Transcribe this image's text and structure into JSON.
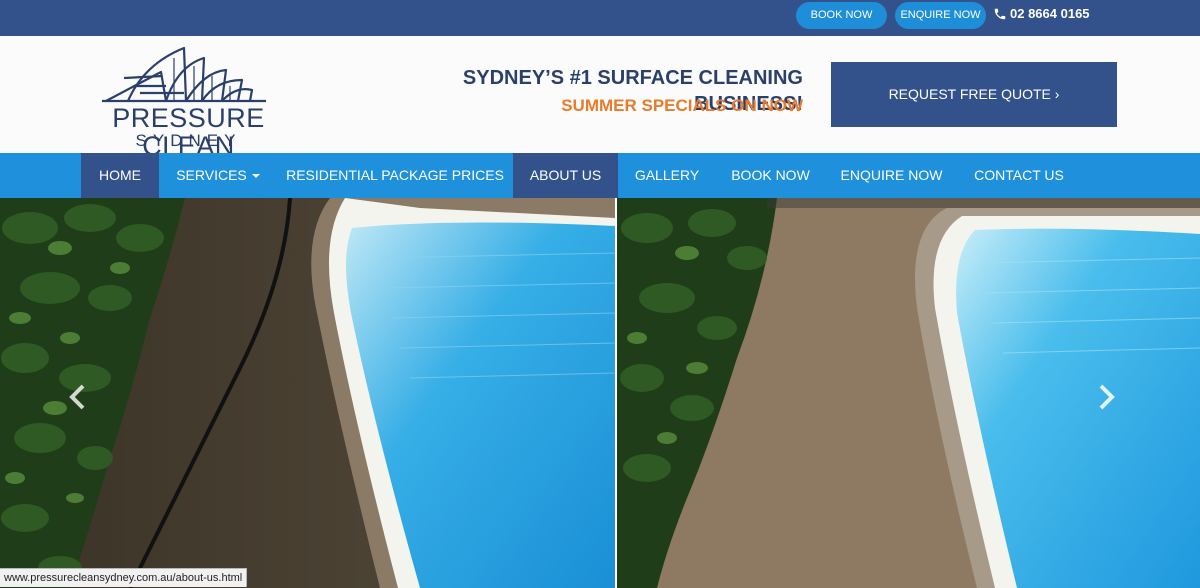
{
  "topbar": {
    "book_now": "BOOK NOW",
    "enquire_now": "ENQUIRE NOW",
    "phone": "02 8664 0165"
  },
  "logo": {
    "name": "PRESSURE CLEAN",
    "sub": "SYDNEY"
  },
  "header": {
    "tagline": "SYDNEY’S #1 SURFACE CLEANING BUSINESS!",
    "specials": "SUMMER SPECIALS ON NOW",
    "quote_button": "REQUEST FREE QUOTE ›"
  },
  "nav": {
    "items": [
      {
        "label": "HOME",
        "active": true
      },
      {
        "label": "SERVICES",
        "dropdown": true
      },
      {
        "label": "RESIDENTIAL PACKAGE PRICES"
      },
      {
        "label": "ABOUT US",
        "active": true
      },
      {
        "label": "GALLERY"
      },
      {
        "label": "BOOK NOW"
      },
      {
        "label": "ENQUIRE NOW"
      },
      {
        "label": "CONTACT US"
      }
    ]
  },
  "status_bar": {
    "url": "www.pressurecleansydney.com.au/about-us.html"
  },
  "colors": {
    "topbar": "#33528c",
    "accent_blue": "#1e90dc",
    "navy": "#2b3f6b",
    "orange": "#e87b2c"
  },
  "icons": {
    "phone": "phone-icon",
    "prev": "chevron-left-icon",
    "next": "chevron-right-icon"
  }
}
